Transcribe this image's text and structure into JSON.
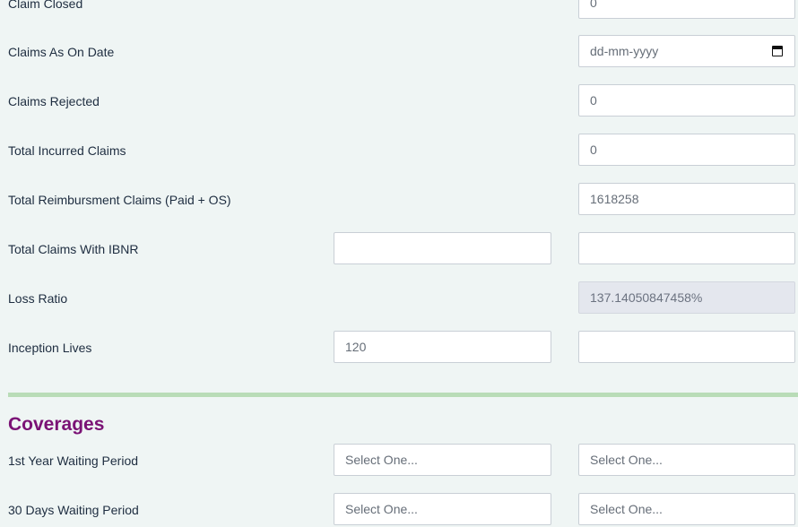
{
  "rows": [
    {
      "label": "Claim Closed",
      "col2": "0"
    },
    {
      "label": "Claims As On Date",
      "col2": "dd-mm-yyyy"
    },
    {
      "label": "Claims Rejected",
      "col2": "0"
    },
    {
      "label": "Total Incurred Claims",
      "col2": "0"
    },
    {
      "label": "Total Reimbursment Claims (Paid + OS)",
      "col2": "1618258"
    },
    {
      "label": "Total Claims With IBNR",
      "col1": "",
      "col2": ""
    },
    {
      "label": "Loss Ratio",
      "col2": "137.14050847458%"
    },
    {
      "label": "Inception Lives",
      "col1": "120",
      "col2": ""
    }
  ],
  "coverages": {
    "title": "Coverages",
    "rows": [
      {
        "label": "1st Year Waiting Period",
        "col1": "Select One...",
        "col2": "Select One..."
      },
      {
        "label": "30 Days Waiting Period",
        "col1": "Select One...",
        "col2": "Select One..."
      }
    ]
  }
}
